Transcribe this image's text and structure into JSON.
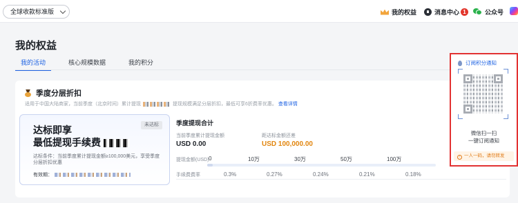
{
  "header": {
    "edition": "全球收款标准版",
    "nav": [
      {
        "label": "我的权益",
        "icon": "crown-icon"
      },
      {
        "label": "消息中心",
        "icon": "bell-icon",
        "badge": "1"
      },
      {
        "label": "公众号",
        "icon": "wechat-icon"
      }
    ]
  },
  "page": {
    "title": "我的权益",
    "tabs": [
      "我的活动",
      "核心规模数据",
      "我的积分"
    ],
    "active_tab": "我的活动"
  },
  "section": {
    "title": "季度分层折扣",
    "desc_before": "适用于中国大陆商家，当前季度（北京时间）累计提现",
    "desc_after": "提现规模满足分层折扣，最低可享6折费率优惠。",
    "desc_link": "查看详情"
  },
  "promo": {
    "line1": "达标即享",
    "line2": "最低提现手续费",
    "status": "未达标",
    "condition": "达标条件：当前季度累计提现金额≥100,000美元，享受季度分层折扣优惠",
    "valid_label": "有效期："
  },
  "quarter": {
    "title": "季度提现合计",
    "current_label": "当前季度累计提现金额",
    "current_value": "USD 0.00",
    "gap_label": "距达标金额还差",
    "gap_value": "USD 100,000.00",
    "amount_label": "提现金额(USD)",
    "ticks": [
      "0",
      "10万",
      "30万",
      "50万",
      "100万"
    ],
    "rate_label": "手续费费率",
    "rates": [
      "0.3%",
      "0.27%",
      "0.24%",
      "0.21%",
      "0.18%"
    ],
    "progress": 0,
    "accent": "#e2860f"
  },
  "qr_panel": {
    "title": "订阅积分通知",
    "line1": "微信扫一扫",
    "line2": "一键订阅通知",
    "note": "一人一码，请勿转发",
    "border_color": "#e23131"
  }
}
